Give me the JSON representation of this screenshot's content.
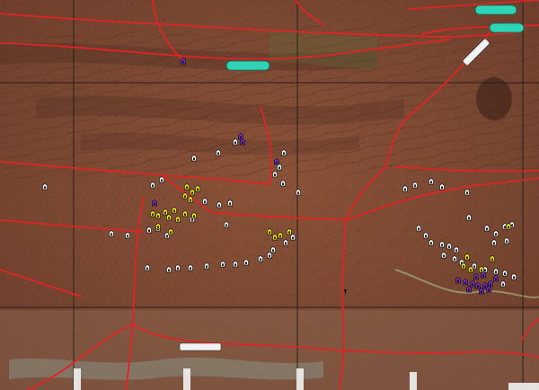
{
  "map": {
    "road_labels": {
      "top_right_1": "",
      "top_right_2": "",
      "upper_middle": "",
      "diagonal_highway": "",
      "bottom_highway": ""
    },
    "axis_labels": {
      "bottom_1": "",
      "bottom_2": "",
      "bottom_3": "",
      "bottom_4": "",
      "bottom_5": ""
    },
    "colors": {
      "terrain": "#7a4a33",
      "road": "#e02424",
      "grid": "#1a1a1a",
      "marker_yellow": "#f2e600",
      "marker_purple": "#7a2dbf",
      "marker_white": "#f2f2f2",
      "label_teal": "#2fd3b6"
    }
  }
}
